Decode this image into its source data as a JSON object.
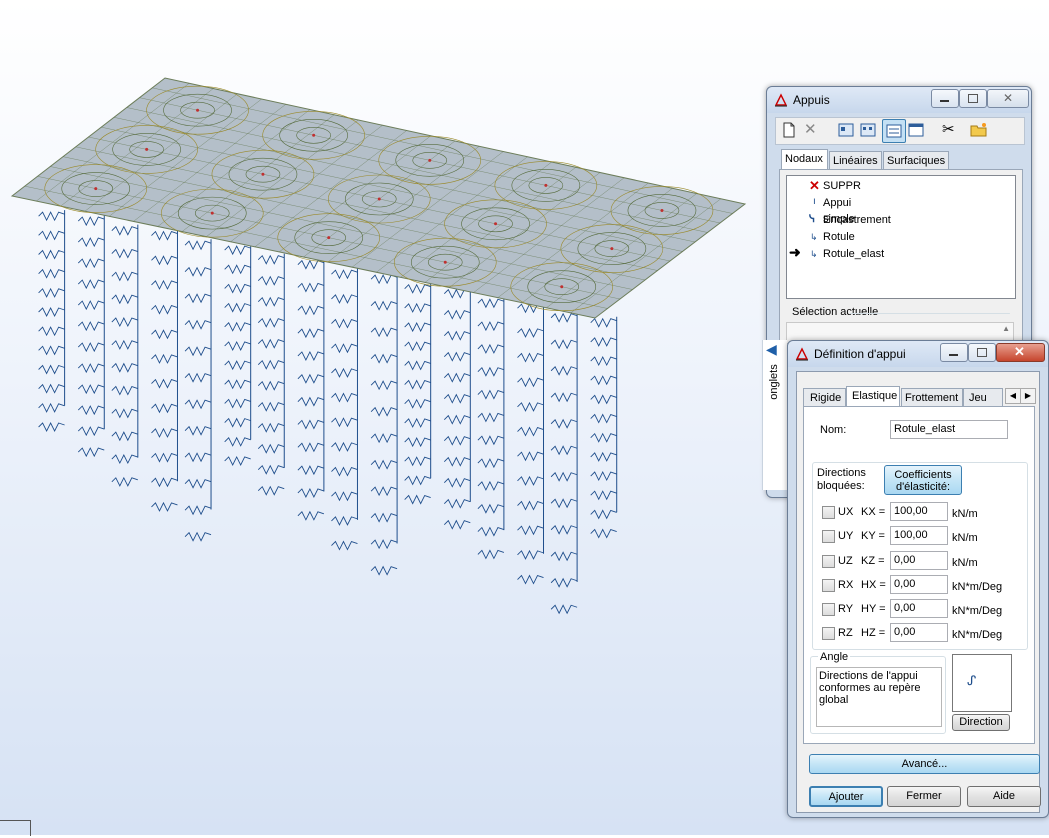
{
  "appuis": {
    "title": "Appuis",
    "tabs": [
      "Nodaux",
      "Linéaires",
      "Surfaciques"
    ],
    "list": [
      {
        "label": "SUPPR",
        "icon": "delete-x-icon"
      },
      {
        "label": "Appui simple",
        "icon": "simple-support-icon"
      },
      {
        "label": "Encastrement",
        "icon": "fixed-support-icon"
      },
      {
        "label": "Rotule",
        "icon": "hinge-icon"
      },
      {
        "label": "Rotule_elast",
        "icon": "elastic-hinge-icon",
        "current": true
      }
    ],
    "selection_label": "Sélection actuelle",
    "side_tab_label": "onglets"
  },
  "definition": {
    "title": "Définition d'appui",
    "tabs": [
      "Rigide",
      "Elastique",
      "Frottement",
      "Jeu"
    ],
    "active_tab": "Elastique",
    "name_label": "Nom:",
    "name_value": "Rotule_elast",
    "blocked_label_1": "Directions",
    "blocked_label_2": "bloquées:",
    "coeff_button_1": "Coefficients",
    "coeff_button_2": "d'élasticité:",
    "rows": [
      {
        "dir": "UX",
        "coef": "KX =",
        "value": "100,00",
        "unit": "kN/m"
      },
      {
        "dir": "UY",
        "coef": "KY =",
        "value": "100,00",
        "unit": "kN/m"
      },
      {
        "dir": "UZ",
        "coef": "KZ =",
        "value": "0,00",
        "unit": "kN/m"
      },
      {
        "dir": "RX",
        "coef": "HX =",
        "value": "0,00",
        "unit": "kN*m/Deg"
      },
      {
        "dir": "RY",
        "coef": "HY =",
        "value": "0,00",
        "unit": "kN*m/Deg"
      },
      {
        "dir": "RZ",
        "coef": "HZ =",
        "value": "0,00",
        "unit": "kN*m/Deg"
      }
    ],
    "angle_label": "Angle",
    "angle_text": [
      "Directions de l'appui",
      "conformes au repère",
      "global"
    ],
    "direction_button": "Direction",
    "advanced_button": "Avancé...",
    "add_button": "Ajouter",
    "close_button": "Fermer",
    "help_button": "Aide"
  },
  "colors": {
    "slab_fill": "#b4bfc9",
    "mesh_line": "#556b3c",
    "spring_color": "#1f4e8c",
    "accent": "#3c7fb1"
  }
}
